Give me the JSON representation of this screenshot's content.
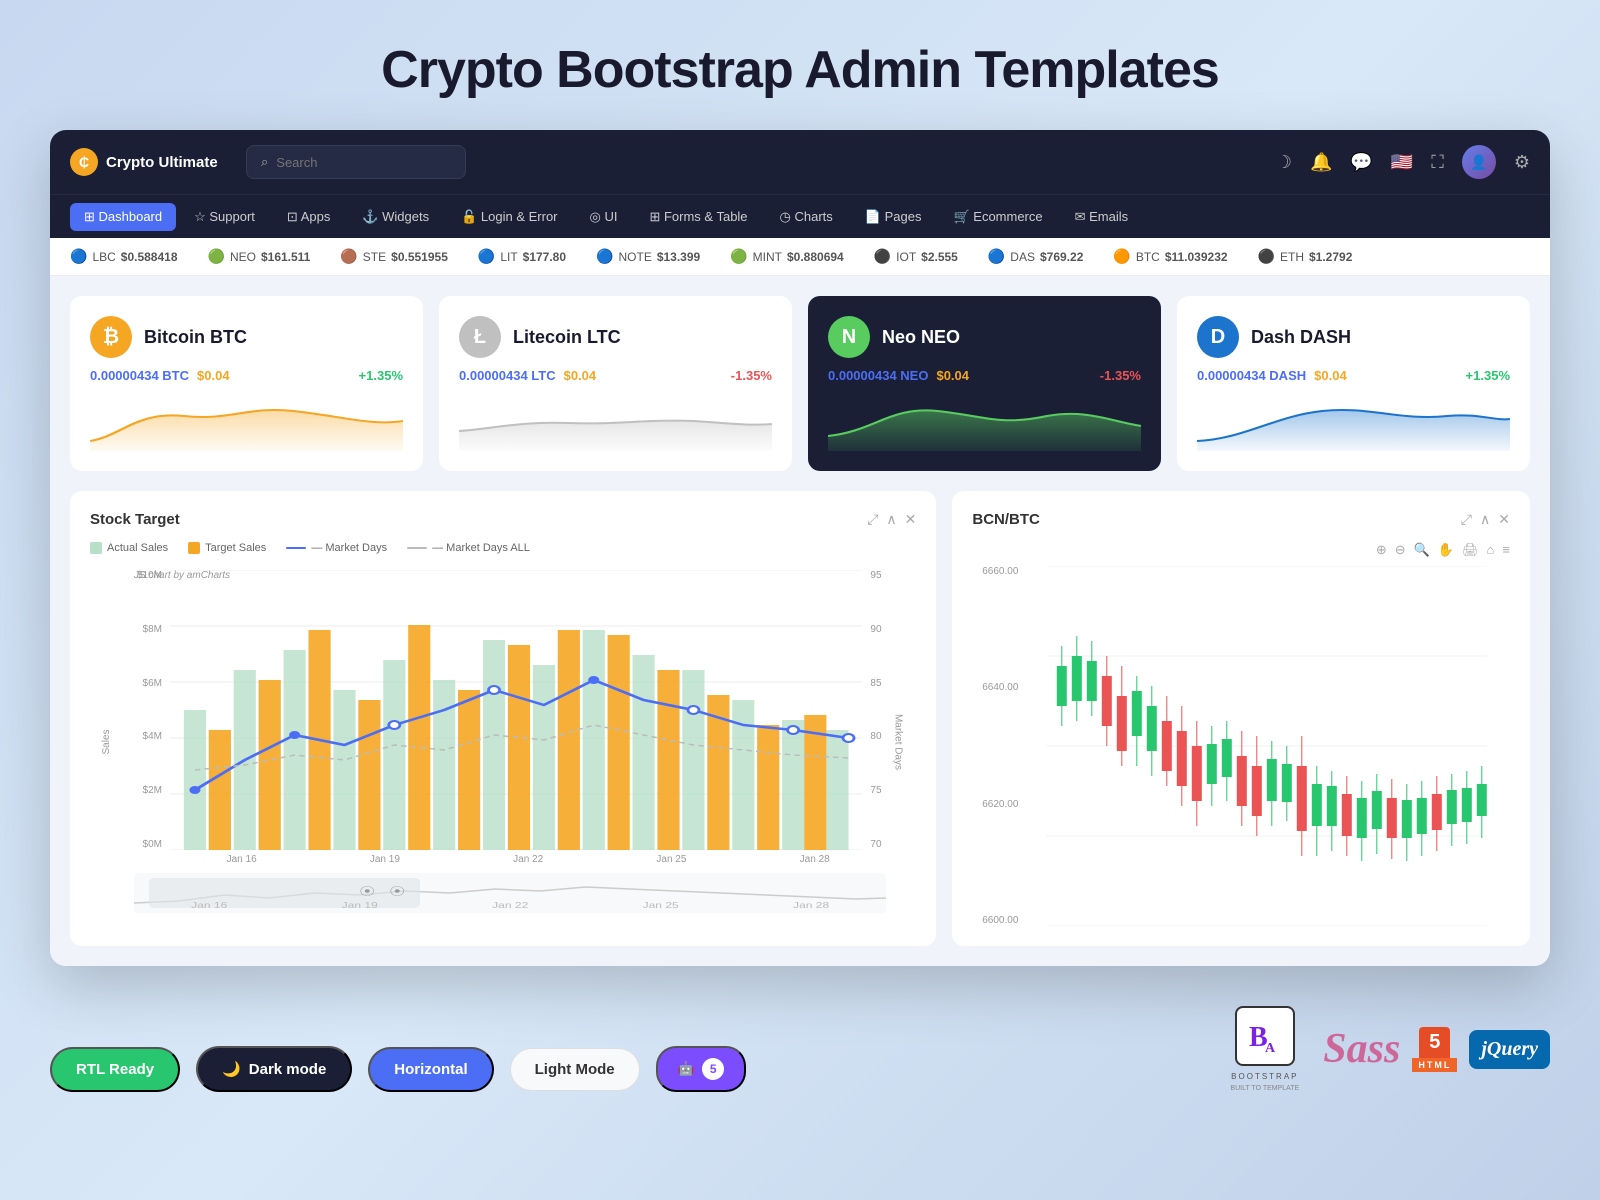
{
  "page": {
    "title": "Crypto Bootstrap Admin Templates"
  },
  "navbar": {
    "brand": "Crypto Ultimate",
    "brand_icon": "₿",
    "search_placeholder": "Search",
    "menu": [
      {
        "id": "dashboard",
        "label": "Dashboard",
        "icon": "⊞",
        "active": true
      },
      {
        "id": "support",
        "label": "Support",
        "icon": "☆"
      },
      {
        "id": "apps",
        "label": "Apps",
        "icon": "⊡"
      },
      {
        "id": "widgets",
        "label": "Widgets",
        "icon": "⚓"
      },
      {
        "id": "login",
        "label": "Login & Error",
        "icon": "🔒"
      },
      {
        "id": "ui",
        "label": "UI",
        "icon": "◎"
      },
      {
        "id": "forms",
        "label": "Forms & Table",
        "icon": "⊞"
      },
      {
        "id": "charts",
        "label": "Charts",
        "icon": "◷"
      },
      {
        "id": "pages",
        "label": "Pages",
        "icon": "📄"
      },
      {
        "id": "ecommerce",
        "label": "Ecommerce",
        "icon": "🛒"
      },
      {
        "id": "emails",
        "label": "Emails",
        "icon": "✉"
      }
    ]
  },
  "ticker": {
    "items": [
      {
        "icon": "🔵",
        "symbol": "LBC",
        "price": "$0.588418"
      },
      {
        "icon": "🟢",
        "symbol": "NEO",
        "price": "$161.511"
      },
      {
        "icon": "🟤",
        "symbol": "STE",
        "price": "$0.551955"
      },
      {
        "icon": "🔵",
        "symbol": "LIT",
        "price": "$177.80"
      },
      {
        "icon": "🔵",
        "symbol": "NOTE",
        "price": "$13.399"
      },
      {
        "icon": "🟢",
        "symbol": "MINT",
        "price": "$0.880694"
      },
      {
        "icon": "⚫",
        "symbol": "IOT",
        "price": "$2.555"
      },
      {
        "icon": "🔵",
        "symbol": "DAS",
        "price": "$769.22"
      },
      {
        "icon": "🟠",
        "symbol": "BTC",
        "price": "$11.039232"
      },
      {
        "icon": "⚫",
        "symbol": "ETH",
        "price": "$1.2792"
      }
    ]
  },
  "crypto_cards": [
    {
      "id": "btc",
      "name": "Bitcoin BTC",
      "icon": "₿",
      "logo_class": "btc",
      "amount": "0.00000434 BTC",
      "usd": "$0.04",
      "change": "+1.35%",
      "change_type": "up",
      "highlighted": false
    },
    {
      "id": "ltc",
      "name": "Litecoin LTC",
      "icon": "Ł",
      "logo_class": "ltc",
      "amount": "0.00000434 LTC",
      "usd": "$0.04",
      "change": "-1.35%",
      "change_type": "down",
      "highlighted": false
    },
    {
      "id": "neo",
      "name": "Neo NEO",
      "icon": "N",
      "logo_class": "neo",
      "amount": "0.00000434 NEO",
      "usd": "$0.04",
      "change": "-1.35%",
      "change_type": "down",
      "highlighted": true
    },
    {
      "id": "dash",
      "name": "Dash DASH",
      "icon": "D",
      "logo_class": "dash",
      "amount": "0.00000434 DASH",
      "usd": "$0.04",
      "change": "+1.35%",
      "change_type": "up",
      "highlighted": false
    }
  ],
  "stock_chart": {
    "title": "Stock Target",
    "subtitle": "JS chart by amCharts",
    "legend": [
      {
        "type": "bar",
        "color": "#b8e0c8",
        "label": "Actual Sales"
      },
      {
        "type": "bar",
        "color": "#f5a623",
        "label": "Target Sales"
      },
      {
        "type": "line",
        "color": "#4c6ef5",
        "label": "Market Days"
      },
      {
        "type": "line",
        "color": "#ccc",
        "label": "Market Days ALL"
      }
    ],
    "y_axis_left": [
      "$10M",
      "$8M",
      "$6M",
      "$4M",
      "$2M",
      "$0M"
    ],
    "y_axis_right": [
      "95",
      "90",
      "85",
      "80",
      "75",
      "70"
    ],
    "x_axis": [
      "Jan 16",
      "Jan 19",
      "Jan 22",
      "Jan 25",
      "Jan 28"
    ],
    "y_label_left": "Sales",
    "y_label_right": "Market Days"
  },
  "bcn_chart": {
    "title": "BCN/BTC",
    "prices": [
      "6660.00",
      "6640.00",
      "6620.00",
      "6600.00"
    ]
  },
  "badges": [
    {
      "label": "RTL Ready",
      "style": "green"
    },
    {
      "label": "Dark mode",
      "style": "dark",
      "icon": "🌙"
    },
    {
      "label": "Horizontal",
      "style": "blue"
    },
    {
      "label": "Light Mode",
      "style": "light"
    },
    {
      "label": "5",
      "style": "purple",
      "icon": "🤖"
    }
  ],
  "tech_logos": [
    {
      "name": "Bootstrap",
      "type": "bootstrap"
    },
    {
      "name": "Sass",
      "type": "sass"
    },
    {
      "name": "HTML5",
      "type": "html5"
    },
    {
      "name": "jQuery",
      "type": "jquery"
    }
  ]
}
